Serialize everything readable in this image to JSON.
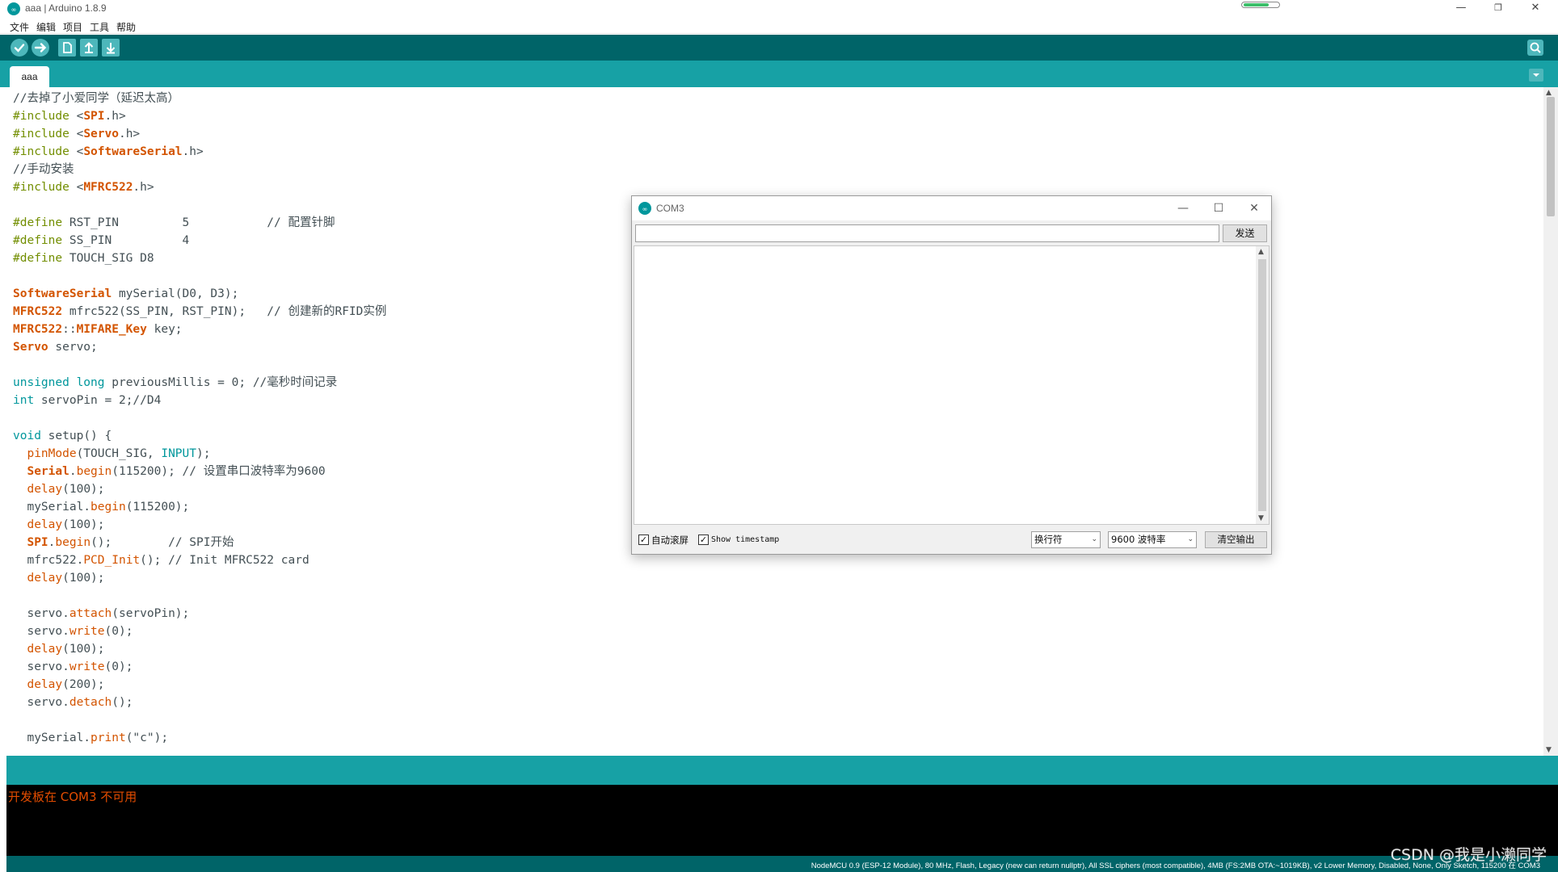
{
  "window": {
    "title": "aaa | Arduino 1.8.9",
    "minimize": "—",
    "restore": "❐",
    "close": "✕",
    "progress_fraction": 0.7
  },
  "menu": [
    "文件",
    "编辑",
    "项目",
    "工具",
    "帮助"
  ],
  "toolbar": {
    "verify_icon": "checkmark-icon",
    "upload_icon": "arrow-right-icon",
    "new_icon": "new-file-icon",
    "open_icon": "open-arrow-up-icon",
    "save_icon": "save-arrow-down-icon",
    "serial_icon": "magnifier-icon"
  },
  "tabs": [
    {
      "label": "aaa"
    }
  ],
  "editor": {
    "lines": [
      [
        {
          "t": "//去掉了小爱同学（延迟太高）",
          "c": "tk-plain"
        }
      ],
      [
        {
          "t": "#include ",
          "c": "tk-kw"
        },
        {
          "t": "<",
          "c": "tk-plain"
        },
        {
          "t": "SPI",
          "c": "tk-cls"
        },
        {
          "t": ".h>",
          "c": "tk-plain"
        }
      ],
      [
        {
          "t": "#include ",
          "c": "tk-kw"
        },
        {
          "t": "<",
          "c": "tk-plain"
        },
        {
          "t": "Servo",
          "c": "tk-cls"
        },
        {
          "t": ".h>",
          "c": "tk-plain"
        }
      ],
      [
        {
          "t": "#include ",
          "c": "tk-kw"
        },
        {
          "t": "<",
          "c": "tk-plain"
        },
        {
          "t": "SoftwareSerial",
          "c": "tk-cls"
        },
        {
          "t": ".h>",
          "c": "tk-plain"
        }
      ],
      [
        {
          "t": "//手动安装",
          "c": "tk-plain"
        }
      ],
      [
        {
          "t": "#include ",
          "c": "tk-kw"
        },
        {
          "t": "<",
          "c": "tk-plain"
        },
        {
          "t": "MFRC522",
          "c": "tk-cls"
        },
        {
          "t": ".h>",
          "c": "tk-plain"
        }
      ],
      [],
      [
        {
          "t": "#define ",
          "c": "tk-kw"
        },
        {
          "t": "RST_PIN         5           // 配置针脚",
          "c": "tk-plain"
        }
      ],
      [
        {
          "t": "#define ",
          "c": "tk-kw"
        },
        {
          "t": "SS_PIN          4",
          "c": "tk-plain"
        }
      ],
      [
        {
          "t": "#define ",
          "c": "tk-kw"
        },
        {
          "t": "TOUCH_SIG D8",
          "c": "tk-plain"
        }
      ],
      [],
      [
        {
          "t": "SoftwareSerial",
          "c": "tk-cls"
        },
        {
          "t": " mySerial(D0, D3);",
          "c": "tk-plain"
        }
      ],
      [
        {
          "t": "MFRC522",
          "c": "tk-cls"
        },
        {
          "t": " mfrc522(SS_PIN, RST_PIN);   // 创建新的RFID实例",
          "c": "tk-plain"
        }
      ],
      [
        {
          "t": "MFRC522",
          "c": "tk-cls"
        },
        {
          "t": "::",
          "c": "tk-plain"
        },
        {
          "t": "MIFARE_Key",
          "c": "tk-cls"
        },
        {
          "t": " key;",
          "c": "tk-plain"
        }
      ],
      [
        {
          "t": "Servo",
          "c": "tk-cls"
        },
        {
          "t": " servo;",
          "c": "tk-plain"
        }
      ],
      [],
      [
        {
          "t": "unsigned",
          "c": "tk-type"
        },
        {
          "t": " ",
          "c": "tk-plain"
        },
        {
          "t": "long",
          "c": "tk-type"
        },
        {
          "t": " previousMillis = 0; //毫秒时间记录",
          "c": "tk-plain"
        }
      ],
      [
        {
          "t": "int",
          "c": "tk-type"
        },
        {
          "t": " servoPin = 2;//D4",
          "c": "tk-plain"
        }
      ],
      [],
      [
        {
          "t": "void",
          "c": "tk-type"
        },
        {
          "t": " ",
          "c": "tk-plain"
        },
        {
          "t": "setup",
          "c": "tk-plain"
        },
        {
          "t": "() {",
          "c": "tk-plain"
        }
      ],
      [
        {
          "t": "  ",
          "c": "tk-plain"
        },
        {
          "t": "pinMode",
          "c": "tk-fn"
        },
        {
          "t": "(TOUCH_SIG, ",
          "c": "tk-plain"
        },
        {
          "t": "INPUT",
          "c": "tk-type"
        },
        {
          "t": ");",
          "c": "tk-plain"
        }
      ],
      [
        {
          "t": "  ",
          "c": "tk-plain"
        },
        {
          "t": "Serial",
          "c": "tk-cls"
        },
        {
          "t": ".",
          "c": "tk-plain"
        },
        {
          "t": "begin",
          "c": "tk-fn"
        },
        {
          "t": "(115200); // 设置串口波特率为9600",
          "c": "tk-plain"
        }
      ],
      [
        {
          "t": "  ",
          "c": "tk-plain"
        },
        {
          "t": "delay",
          "c": "tk-fn"
        },
        {
          "t": "(100);",
          "c": "tk-plain"
        }
      ],
      [
        {
          "t": "  mySerial.",
          "c": "tk-plain"
        },
        {
          "t": "begin",
          "c": "tk-fn"
        },
        {
          "t": "(115200);",
          "c": "tk-plain"
        }
      ],
      [
        {
          "t": "  ",
          "c": "tk-plain"
        },
        {
          "t": "delay",
          "c": "tk-fn"
        },
        {
          "t": "(100);",
          "c": "tk-plain"
        }
      ],
      [
        {
          "t": "  ",
          "c": "tk-plain"
        },
        {
          "t": "SPI",
          "c": "tk-cls"
        },
        {
          "t": ".",
          "c": "tk-plain"
        },
        {
          "t": "begin",
          "c": "tk-fn"
        },
        {
          "t": "();        // SPI开始",
          "c": "tk-plain"
        }
      ],
      [
        {
          "t": "  mfrc522.",
          "c": "tk-plain"
        },
        {
          "t": "PCD_Init",
          "c": "tk-fn"
        },
        {
          "t": "(); // Init MFRC522 card",
          "c": "tk-plain"
        }
      ],
      [
        {
          "t": "  ",
          "c": "tk-plain"
        },
        {
          "t": "delay",
          "c": "tk-fn"
        },
        {
          "t": "(100);",
          "c": "tk-plain"
        }
      ],
      [],
      [
        {
          "t": "  servo.",
          "c": "tk-plain"
        },
        {
          "t": "attach",
          "c": "tk-fn"
        },
        {
          "t": "(servoPin);",
          "c": "tk-plain"
        }
      ],
      [
        {
          "t": "  servo.",
          "c": "tk-plain"
        },
        {
          "t": "write",
          "c": "tk-fn"
        },
        {
          "t": "(0);",
          "c": "tk-plain"
        }
      ],
      [
        {
          "t": "  ",
          "c": "tk-plain"
        },
        {
          "t": "delay",
          "c": "tk-fn"
        },
        {
          "t": "(100);",
          "c": "tk-plain"
        }
      ],
      [
        {
          "t": "  servo.",
          "c": "tk-plain"
        },
        {
          "t": "write",
          "c": "tk-fn"
        },
        {
          "t": "(0);",
          "c": "tk-plain"
        }
      ],
      [
        {
          "t": "  ",
          "c": "tk-plain"
        },
        {
          "t": "delay",
          "c": "tk-fn"
        },
        {
          "t": "(200);",
          "c": "tk-plain"
        }
      ],
      [
        {
          "t": "  servo.",
          "c": "tk-plain"
        },
        {
          "t": "detach",
          "c": "tk-fn"
        },
        {
          "t": "();",
          "c": "tk-plain"
        }
      ],
      [],
      [
        {
          "t": "  mySerial.",
          "c": "tk-plain"
        },
        {
          "t": "print",
          "c": "tk-fn"
        },
        {
          "t": "(\"c\");",
          "c": "tk-plain"
        }
      ]
    ]
  },
  "console": {
    "message": "开发板在 COM3 不可用"
  },
  "status": {
    "board_info": "NodeMCU 0.9 (ESP-12 Module), 80 MHz, Flash, Legacy (new can return nullptr), All SSL ciphers (most compatible), 4MB (FS:2MB OTA:~1019KB), v2 Lower Memory, Disabled, None, Only Sketch, 115200 在 COM3"
  },
  "watermark": "CSDN @我是小濑同学",
  "serial_monitor": {
    "title": "COM3",
    "minimize": "—",
    "maximize": "☐",
    "close": "✕",
    "input_value": "",
    "send_label": "发送",
    "autoscroll_label": "自动滚屏",
    "autoscroll_checked": true,
    "timestamp_label": "Show timestamp",
    "timestamp_checked": true,
    "line_ending": "换行符",
    "baud_rate": "9600 波特率",
    "clear_label": "清空输出",
    "check_mark": "✓",
    "dropdown_arrow": "⌄",
    "scroll_up": "▲",
    "scroll_down": "▼"
  },
  "colors": {
    "teal_dark": "#006468",
    "teal": "#17a1a5",
    "keyword": "#728e00",
    "type": "#00979c",
    "function": "#d35400",
    "console_error": "#e34c00"
  }
}
